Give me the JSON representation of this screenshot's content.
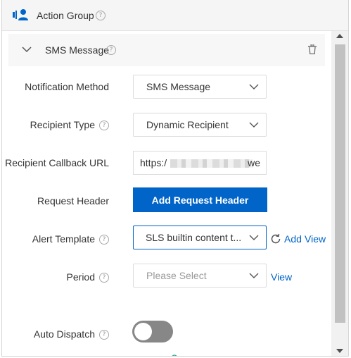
{
  "header": {
    "title": "Action Group",
    "help": "?"
  },
  "section": {
    "title": "SMS Message",
    "help": "?"
  },
  "form": {
    "notification_method": {
      "label": "Notification Method",
      "value": "SMS Message"
    },
    "recipient_type": {
      "label": "Recipient Type",
      "help": "?",
      "value": "Dynamic Recipient"
    },
    "callback_url": {
      "label": "Recipient Callback URL",
      "value_start": "https:/",
      "value_end": "we"
    },
    "request_header": {
      "label": "Request Header",
      "button_label": "Add Request Header"
    },
    "alert_template": {
      "label": "Alert Template",
      "help": "?",
      "value": "SLS builtin content t...",
      "add_label": "Add",
      "view_label": "View"
    },
    "period": {
      "label": "Period",
      "help": "?",
      "placeholder": "Please Select",
      "view_label": "View"
    },
    "auto_dispatch": {
      "label": "Auto Dispatch",
      "help": "?",
      "enabled": false
    }
  },
  "colors": {
    "accent": "#0064c8",
    "toggle_off": "#878787"
  },
  "icons": {
    "header": "user-group-icon",
    "collapse": "chevron-down-icon",
    "delete": "trash-icon",
    "refresh": "refresh-icon"
  }
}
